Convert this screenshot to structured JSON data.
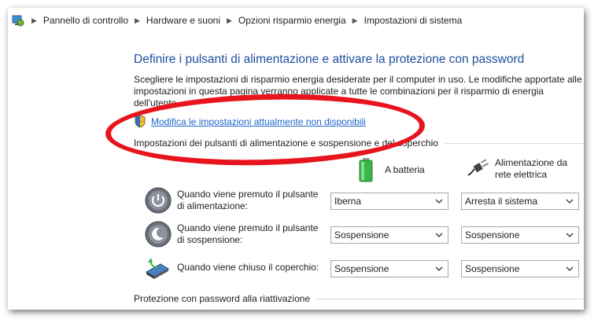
{
  "breadcrumb": {
    "items": [
      "Pannello di controllo",
      "Hardware e suoni",
      "Opzioni risparmio energia",
      "Impostazioni di sistema"
    ]
  },
  "page": {
    "title": "Definire i pulsanti di alimentazione e attivare la protezione con password",
    "description": "Scegliere le impostazioni di risparmio energia desiderate per il computer in uso. Le modifiche apportate alle impostazioni in questa pagina verranno applicate a tutte le combinazioni per il risparmio di energia dell'utente.",
    "change_link": "Modifica le impostazioni attualmente non disponibili",
    "section_buttons": "Impostazioni dei pulsanti di alimentazione e sospensione e del coperchio",
    "section_password": "Protezione con password alla riattivazione"
  },
  "columns": {
    "battery": "A batteria",
    "ac_line1": "Alimentazione da",
    "ac_line2": "rete elettrica"
  },
  "rows": [
    {
      "label": "Quando viene premuto il pulsante di alimentazione:",
      "battery": "Iberna",
      "ac": "Arresta il sistema"
    },
    {
      "label": "Quando viene premuto il pulsante di sospensione:",
      "battery": "Sospensione",
      "ac": "Sospensione"
    },
    {
      "label": "Quando viene chiuso il coperchio:",
      "battery": "Sospensione",
      "ac": "Sospensione"
    }
  ],
  "colors": {
    "title": "#1e4f9e",
    "link": "#1e64c8",
    "annotation": "#e8141d"
  }
}
